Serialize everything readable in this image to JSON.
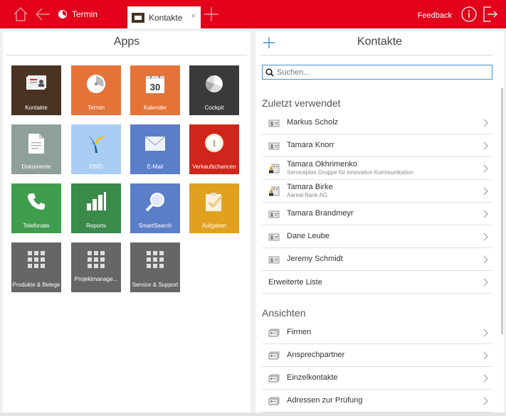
{
  "topbar": {
    "termin_label": "Termin",
    "kontakte_tab_label": "Kontakte",
    "close_glyph": "×",
    "feedback_label": "Feedback",
    "accent": "#e2001a"
  },
  "apps": {
    "title": "Apps",
    "tiles": [
      {
        "label": "Kontakte",
        "color": "#4a3322",
        "icon": "contacts-icon"
      },
      {
        "label": "Termin",
        "color": "#e57338",
        "icon": "pie-clock-icon"
      },
      {
        "label": "Kalender",
        "color": "#e57338",
        "icon": "calendar-icon",
        "icon_text": "30"
      },
      {
        "label": "Cockpit",
        "color": "#3a3a3a",
        "icon": "pie-chart-icon"
      },
      {
        "label": "Dokumente",
        "color": "#8fa09a",
        "icon": "document-icon"
      },
      {
        "label": "EBID",
        "color": "#a9cdf2",
        "icon": "ebid-logo-icon"
      },
      {
        "label": "E-Mail",
        "color": "#5b7ec9",
        "icon": "envelope-icon"
      },
      {
        "label": "Verkaufschancen",
        "color": "#d0251b",
        "icon": "badge-one-icon",
        "icon_text": "1"
      },
      {
        "label": "Telefonate",
        "color": "#3f9e4e",
        "icon": "phone-icon"
      },
      {
        "label": "Reports",
        "color": "#3a8a4a",
        "icon": "bar-chart-icon"
      },
      {
        "label": "SmartSearch",
        "color": "#5b7ec9",
        "icon": "magnifier-icon"
      },
      {
        "label": "Aufgaben",
        "color": "#e0a020",
        "icon": "checklist-icon"
      },
      {
        "label": "Produkte & Belege",
        "color": "#666666",
        "icon": "grid-icon"
      },
      {
        "label": "Projektmanage...",
        "color": "#666666",
        "icon": "grid-icon"
      },
      {
        "label": "Service & Support",
        "color": "#666666",
        "icon": "grid-icon"
      }
    ]
  },
  "kontakte": {
    "title": "Kontakte",
    "search_placeholder": "Suchen...",
    "recent_title": "Zuletzt verwendet",
    "recent": [
      {
        "name": "Markus Scholz",
        "sub": "",
        "icon": "person-card-icon"
      },
      {
        "name": "Tamara Knorr",
        "sub": "",
        "icon": "person-card-icon"
      },
      {
        "name": "Tamara Okhrimenko",
        "sub": "Serviceplan Gruppe für innovative Kommunikation",
        "icon": "person-company-icon"
      },
      {
        "name": "Tamara Birke",
        "sub": "Aareal Bank AG",
        "icon": "person-company-icon"
      },
      {
        "name": "Tamara Brandmeyr",
        "sub": "",
        "icon": "person-card-icon"
      },
      {
        "name": "Dane Leube",
        "sub": "",
        "icon": "person-card-icon"
      },
      {
        "name": "Jeremy Schmidt",
        "sub": "",
        "icon": "person-card-icon"
      }
    ],
    "extended_list_label": "Erweiterte Liste",
    "views_title": "Ansichten",
    "views": [
      {
        "label": "Firmen",
        "icon": "card-stack-icon"
      },
      {
        "label": "Ansprechpartner",
        "icon": "card-stack-icon"
      },
      {
        "label": "Einzelkontakte",
        "icon": "card-stack-icon"
      },
      {
        "label": "Adressen zur Prüfung",
        "icon": "card-stack-icon"
      }
    ]
  }
}
